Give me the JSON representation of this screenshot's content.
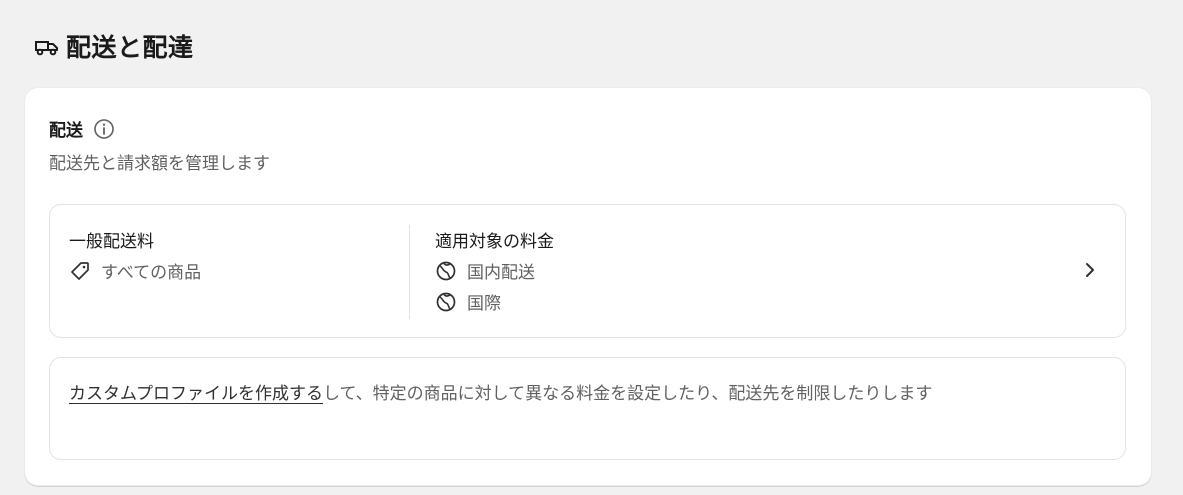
{
  "header": {
    "title": "配送と配達",
    "icon": "truck-icon"
  },
  "shipping": {
    "title": "配送",
    "subtitle": "配送先と請求額を管理します",
    "profile": {
      "name": "一般配送料",
      "products_label": "すべての商品",
      "rates_title": "適用対象の料金",
      "zones": [
        "国内配送",
        "国際"
      ]
    },
    "note": {
      "link_text": "カスタムプロファイルを作成する",
      "text": "して、特定の商品に対して異なる料金を設定したり、配送先を制限したりします"
    }
  }
}
